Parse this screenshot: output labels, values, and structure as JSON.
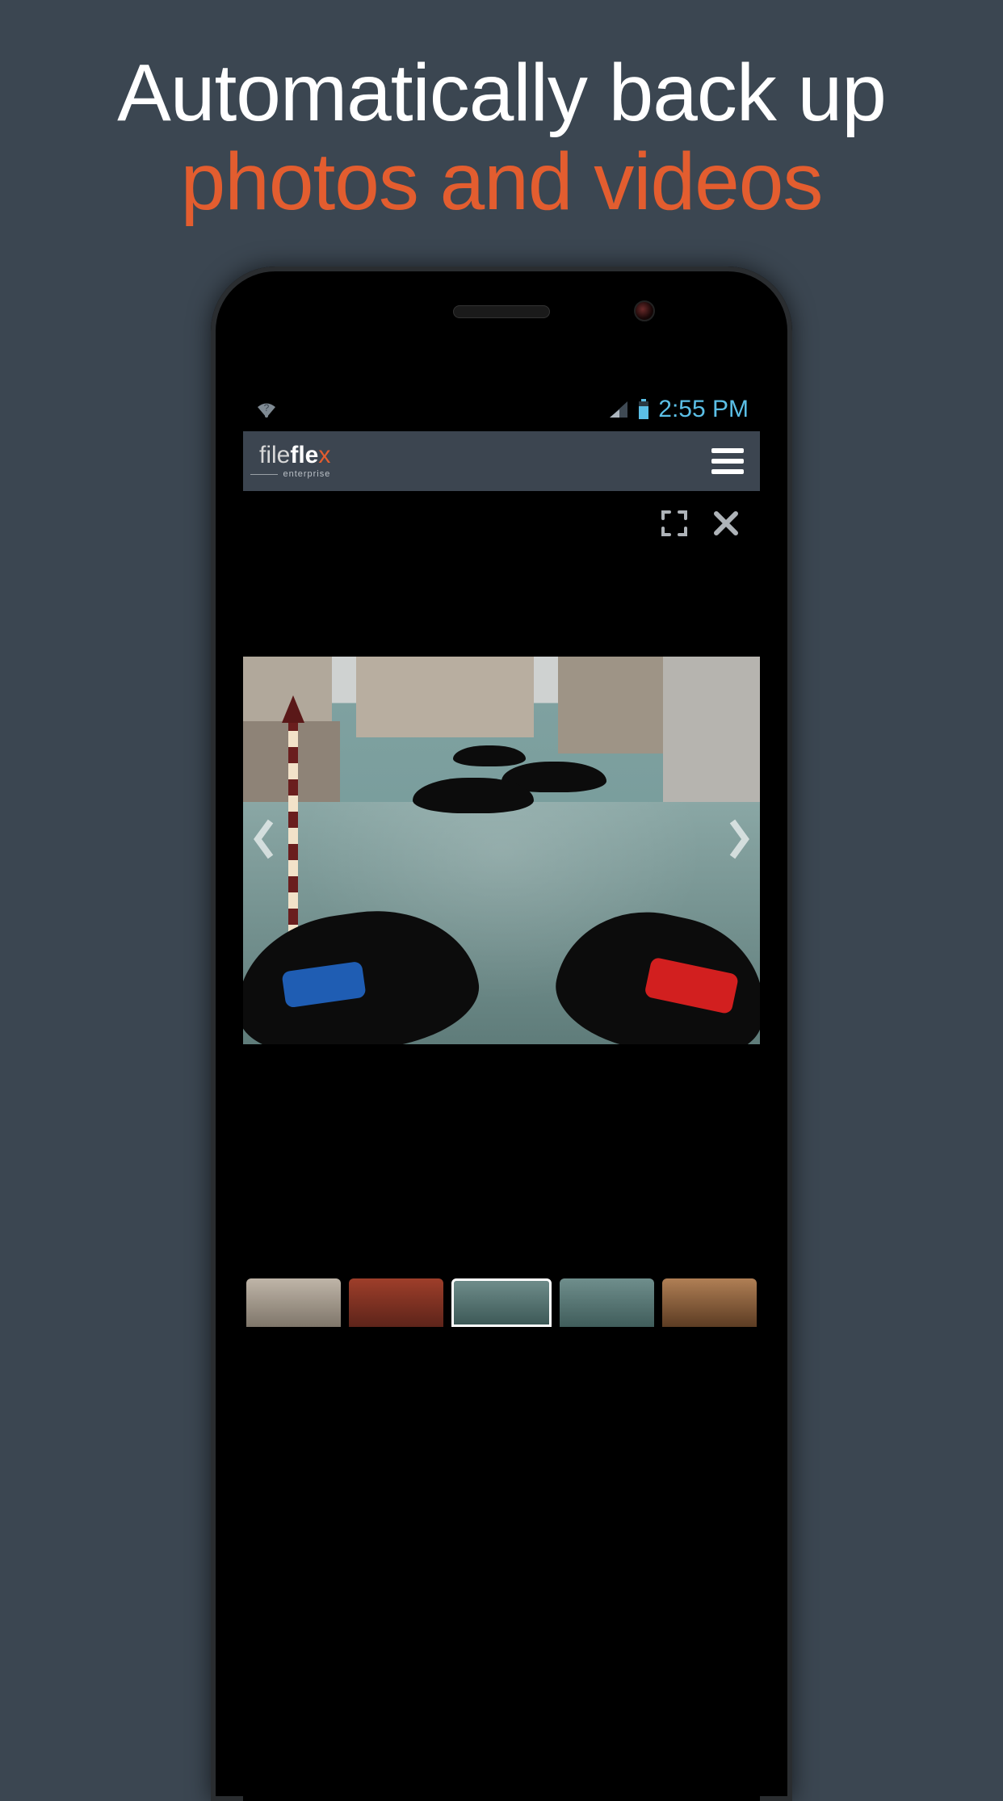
{
  "headline": {
    "line1": "Automatically back up",
    "line2": "photos and videos"
  },
  "status": {
    "time": "2:55 PM"
  },
  "app": {
    "logo_file": "file",
    "logo_fle": "fle",
    "logo_x": "x",
    "logo_sub": "enterprise"
  },
  "viewer": {
    "fullscreen_label": "fullscreen",
    "close_label": "close",
    "prev_label": "previous",
    "next_label": "next"
  },
  "icons": {
    "wifi": "wifi-icon",
    "signal": "signal-icon",
    "battery": "battery-icon",
    "hamburger": "hamburger-icon",
    "fullscreen": "fullscreen-icon",
    "close": "close-icon",
    "chevron_left": "chevron-left-icon",
    "chevron_right": "chevron-right-icon"
  },
  "thumbnails": {
    "count": 5,
    "selected_index": 2
  }
}
